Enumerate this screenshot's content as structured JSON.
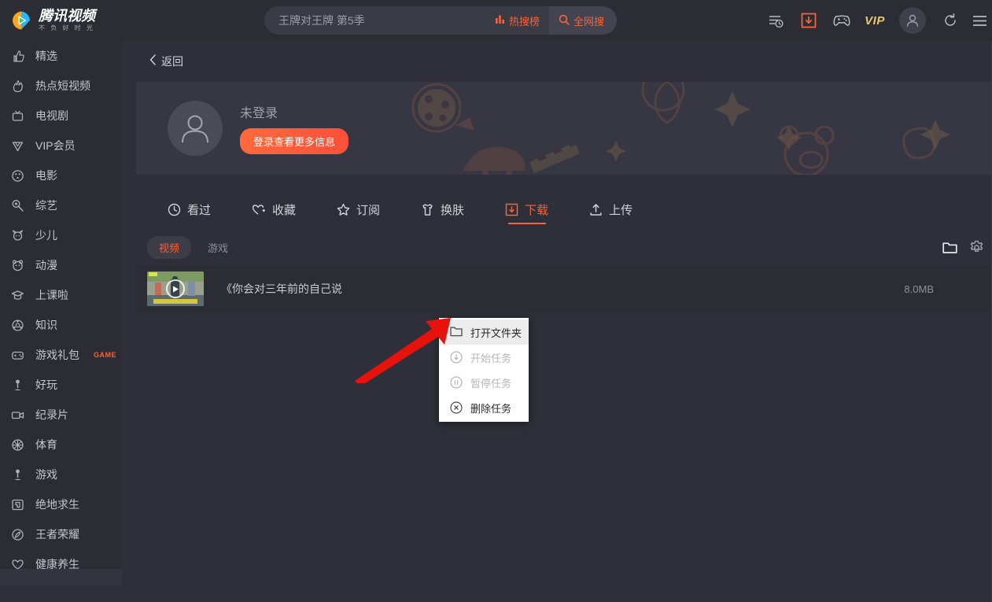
{
  "brand": {
    "logo_title": "腾讯视频",
    "logo_sub": "不 负 好 时 光",
    "accent": "#f5643c",
    "vip_gold": "#e8c673"
  },
  "search": {
    "value": "王牌对王牌 第5季",
    "placeholder": "王牌对王牌 第5季",
    "hot_label": "热搜榜",
    "all_search_label": "全网搜"
  },
  "topbar": {
    "icons": [
      {
        "name": "history-icon",
        "label": "历史"
      },
      {
        "name": "download-icon",
        "label": "下载"
      },
      {
        "name": "gamepad-icon",
        "label": "游戏"
      },
      {
        "name": "vip-icon",
        "label": "VIP"
      }
    ],
    "vip_label": "VIP",
    "refresh_label": "刷新",
    "menu_label": "菜单"
  },
  "sidebar": {
    "items": [
      {
        "label": "精选",
        "icon": "thumbs-up-icon"
      },
      {
        "label": "热点短视频",
        "icon": "fire-icon"
      },
      {
        "label": "电视剧",
        "icon": "tv-icon"
      },
      {
        "label": "VIP会员",
        "icon": "crown-icon"
      },
      {
        "label": "电影",
        "icon": "film-reel-icon"
      },
      {
        "label": "综艺",
        "icon": "microphone-icon"
      },
      {
        "label": "少儿",
        "icon": "child-icon"
      },
      {
        "label": "动漫",
        "icon": "panda-icon"
      },
      {
        "label": "上课啦",
        "icon": "graduation-cap-icon"
      },
      {
        "label": "知识",
        "icon": "knowledge-icon"
      },
      {
        "label": "游戏礼包",
        "icon": "gamepad-icon",
        "badge": "GAME"
      },
      {
        "label": "好玩",
        "icon": "joystick-icon"
      },
      {
        "label": "纪录片",
        "icon": "video-camera-icon"
      },
      {
        "label": "体育",
        "icon": "basketball-icon"
      },
      {
        "label": "游戏",
        "icon": "joystick-icon"
      },
      {
        "label": "绝地求生",
        "icon": "pubg-icon"
      },
      {
        "label": "王者荣耀",
        "icon": "honor-of-kings-icon"
      },
      {
        "label": "健康养生",
        "icon": "heart-icon"
      }
    ]
  },
  "main": {
    "back_label": "返回",
    "profile": {
      "name": "未登录",
      "login_button": "登录查看更多信息"
    },
    "tabs": [
      {
        "label": "看过",
        "icon": "clock-icon",
        "active": false
      },
      {
        "label": "收藏",
        "icon": "heart-plus-icon",
        "active": false
      },
      {
        "label": "订阅",
        "icon": "star-icon",
        "active": false
      },
      {
        "label": "换肤",
        "icon": "shirt-icon",
        "active": false
      },
      {
        "label": "下载",
        "icon": "download-box-icon",
        "active": true
      },
      {
        "label": "上传",
        "icon": "upload-icon",
        "active": false
      }
    ],
    "subtabs": [
      {
        "label": "视频",
        "active": true
      },
      {
        "label": "游戏",
        "active": false
      }
    ],
    "subtab_icons": [
      {
        "name": "folder-icon"
      },
      {
        "name": "gear-icon"
      }
    ],
    "download_item": {
      "title": "《你会对三年前的自己说",
      "size": "8.0MB"
    }
  },
  "context_menu": {
    "items": [
      {
        "label": "打开文件夹",
        "icon": "folder-icon",
        "state": "hover"
      },
      {
        "label": "开始任务",
        "icon": "download-circle-icon",
        "state": "disabled"
      },
      {
        "label": "暂停任务",
        "icon": "pause-circle-icon",
        "state": "disabled"
      },
      {
        "label": "删除任务",
        "icon": "close-circle-icon",
        "state": "enabled"
      }
    ]
  }
}
